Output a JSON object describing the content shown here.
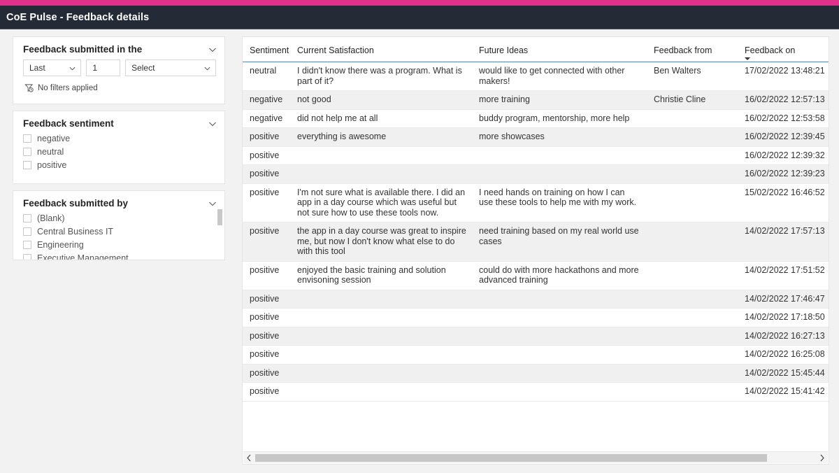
{
  "header": {
    "title": "CoE Pulse - Feedback details",
    "accent_color": "#e2318d",
    "bar_color": "#252b36"
  },
  "filters": {
    "relative_date": {
      "title": "Feedback submitted in the",
      "collapse_icon": "chevron-down-icon",
      "operator_value": "Last",
      "count_value": "1",
      "unit_value": "Select",
      "status_icon": "filter-clock-icon",
      "status_text": "No filters applied"
    },
    "sentiment": {
      "title": "Feedback sentiment",
      "collapse_icon": "chevron-down-icon",
      "options": [
        {
          "label": "negative",
          "checked": false
        },
        {
          "label": "neutral",
          "checked": false
        },
        {
          "label": "positive",
          "checked": false
        }
      ]
    },
    "submitted_by": {
      "title": "Feedback submitted by",
      "collapse_icon": "chevron-down-icon",
      "options": [
        {
          "label": "(Blank)",
          "checked": false
        },
        {
          "label": "Central Business IT",
          "checked": false
        },
        {
          "label": "Engineering",
          "checked": false
        },
        {
          "label": "Executive Management",
          "checked": false
        }
      ]
    }
  },
  "table": {
    "columns": [
      {
        "key": "sentiment",
        "label": "Sentiment",
        "sorted": false
      },
      {
        "key": "current",
        "label": "Current Satisfaction",
        "sorted": false
      },
      {
        "key": "future",
        "label": "Future Ideas",
        "sorted": false
      },
      {
        "key": "from",
        "label": "Feedback from",
        "sorted": false
      },
      {
        "key": "on",
        "label": "Feedback on",
        "sorted": true,
        "sort_direction": "descending",
        "sort_icon": "sort-descending-icon"
      }
    ],
    "rows": [
      {
        "sentiment": "neutral",
        "current": "I didn't know there was a program. What is part of it?",
        "future": "would like to get connected with other makers!",
        "from": "Ben Walters",
        "on": "17/02/2022 13:48:21"
      },
      {
        "sentiment": "negative",
        "current": "not good",
        "future": "more training",
        "from": "Christie Cline",
        "on": "16/02/2022 12:57:13"
      },
      {
        "sentiment": "negative",
        "current": "did not help me at all",
        "future": "buddy program, mentorship, more help",
        "from": "",
        "on": "16/02/2022 12:53:58"
      },
      {
        "sentiment": "positive",
        "current": "everything is awesome",
        "future": "more showcases",
        "from": "",
        "on": "16/02/2022 12:39:45"
      },
      {
        "sentiment": "positive",
        "current": "",
        "future": "",
        "from": "",
        "on": "16/02/2022 12:39:32"
      },
      {
        "sentiment": "positive",
        "current": "",
        "future": "",
        "from": "",
        "on": "16/02/2022 12:39:23"
      },
      {
        "sentiment": "positive",
        "current": "I'm not sure what is available there. I did an app in a day course which was useful but not sure how to use these tools now.",
        "future": "I need hands on training on how I can use these tools to help me with my work.",
        "from": "",
        "on": "15/02/2022 16:46:52"
      },
      {
        "sentiment": "positive",
        "current": "the app in a day course was great to inspire me, but now I don't know what else to do with this tool",
        "future": "need training based on my real world use cases",
        "from": "",
        "on": "14/02/2022 17:57:13"
      },
      {
        "sentiment": "positive",
        "current": "enjoyed the basic training and solution envisoning session",
        "future": "could do with more hackathons and more advanced training",
        "from": "",
        "on": "14/02/2022 17:51:52"
      },
      {
        "sentiment": "positive",
        "current": "",
        "future": "",
        "from": "",
        "on": "14/02/2022 17:46:47"
      },
      {
        "sentiment": "positive",
        "current": "",
        "future": "",
        "from": "",
        "on": "14/02/2022 17:18:50"
      },
      {
        "sentiment": "positive",
        "current": "",
        "future": "",
        "from": "",
        "on": "14/02/2022 16:27:13"
      },
      {
        "sentiment": "positive",
        "current": "",
        "future": "",
        "from": "",
        "on": "14/02/2022 16:25:08"
      },
      {
        "sentiment": "positive",
        "current": "",
        "future": "",
        "from": "",
        "on": "14/02/2022 15:45:44"
      },
      {
        "sentiment": "positive",
        "current": "",
        "future": "",
        "from": "",
        "on": "14/02/2022 15:41:42"
      }
    ],
    "horizontal_scrollbar": {
      "left_arrow_icon": "chevron-left-icon",
      "right_arrow_icon": "chevron-right-icon"
    }
  }
}
